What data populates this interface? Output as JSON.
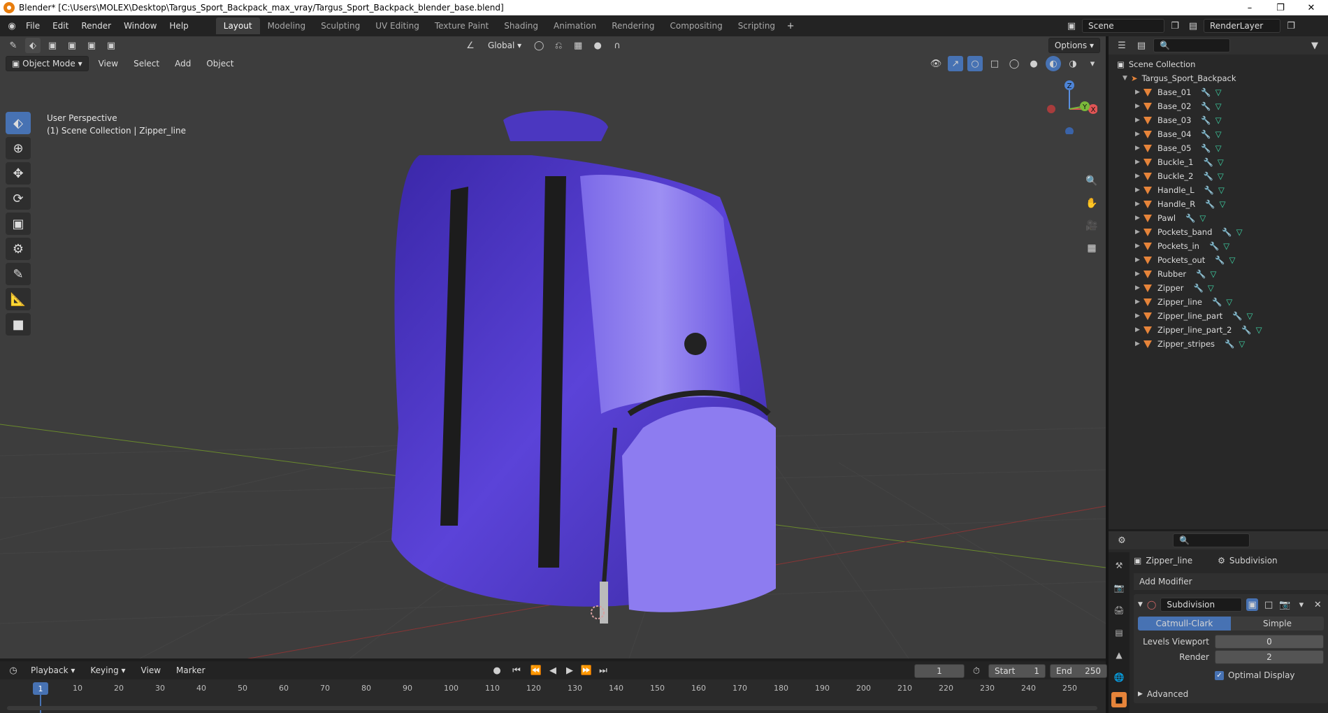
{
  "window": {
    "title": "Blender* [C:\\Users\\MOLEX\\Desktop\\Targus_Sport_Backpack_max_vray/Targus_Sport_Backpack_blender_base.blend]"
  },
  "menu": [
    "File",
    "Edit",
    "Render",
    "Window",
    "Help"
  ],
  "workspaces": [
    "Layout",
    "Modeling",
    "Sculpting",
    "UV Editing",
    "Texture Paint",
    "Shading",
    "Animation",
    "Rendering",
    "Compositing",
    "Scripting"
  ],
  "scene": {
    "name": "Scene",
    "render_layer": "RenderLayer"
  },
  "viewport_header": {
    "transform_orientation": "Global",
    "options_label": "Options",
    "mode": "Object Mode",
    "menus": [
      "View",
      "Select",
      "Add",
      "Object"
    ]
  },
  "viewport": {
    "perspective": "User Perspective",
    "collection_info": "(1) Scene Collection | Zipper_line"
  },
  "gizmo": {
    "x": "X",
    "y": "Y",
    "z": "Z"
  },
  "outliner": {
    "root": "Scene Collection",
    "collection": "Targus_Sport_Backpack",
    "objects": [
      "Base_01",
      "Base_02",
      "Base_03",
      "Base_04",
      "Base_05",
      "Buckle_1",
      "Buckle_2",
      "Handle_L",
      "Handle_R",
      "Pawl",
      "Pockets_band",
      "Pockets_in",
      "Pockets_out",
      "Rubber",
      "Zipper",
      "Zipper_line",
      "Zipper_line_part",
      "Zipper_line_part_2",
      "Zipper_stripes"
    ]
  },
  "properties": {
    "object": "Zipper_line",
    "modifier_breadcrumb": "Subdivision",
    "add_modifier": "Add Modifier",
    "modifier_name": "Subdivision",
    "modes": [
      "Catmull-Clark",
      "Simple"
    ],
    "active_mode": "Catmull-Clark",
    "levels_viewport_label": "Levels Viewport",
    "levels_viewport": "0",
    "render_label": "Render",
    "render": "2",
    "optimal_display": "Optimal Display",
    "advanced": "Advanced"
  },
  "timeline": {
    "menus": [
      "Playback",
      "Keying",
      "View",
      "Marker"
    ],
    "current_frame": "1",
    "start_label": "Start",
    "start": "1",
    "end_label": "End",
    "end": "250",
    "ticks": [
      "10",
      "20",
      "30",
      "40",
      "50",
      "60",
      "70",
      "80",
      "90",
      "100",
      "110",
      "120",
      "130",
      "140",
      "150",
      "160",
      "170",
      "180",
      "190",
      "200",
      "210",
      "220",
      "230",
      "240",
      "250"
    ]
  },
  "colors": {
    "accent": "#4772b3",
    "backpack": "#5a3fd6",
    "object_icon": "#e6843a"
  }
}
